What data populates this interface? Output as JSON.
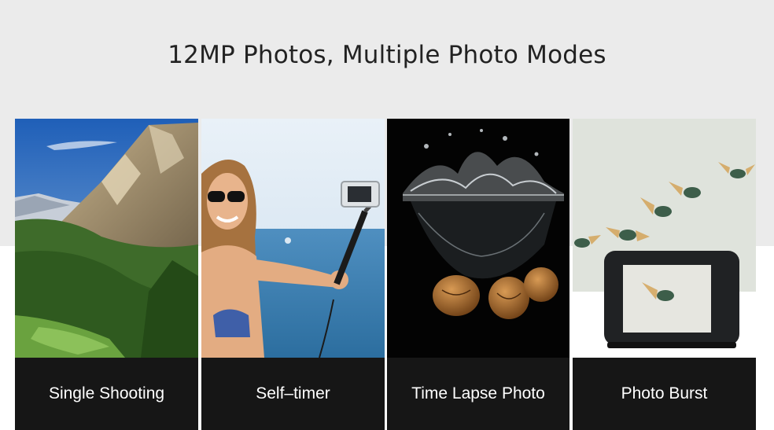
{
  "headline": "12MP Photos, Multiple Photo Modes",
  "panels": [
    {
      "label": "Single Shooting",
      "scene": "mountain-valley"
    },
    {
      "label": "Self–timer",
      "scene": "woman-selfie-stick-beach"
    },
    {
      "label": "Time Lapse Photo",
      "scene": "walnuts-splashing-water"
    },
    {
      "label": "Photo Burst",
      "scene": "flying-beetles-action-camera"
    }
  ],
  "colors": {
    "top_band": "#ebebeb",
    "caption_bg": "#161616",
    "headline_text": "#222222",
    "caption_text": "#ffffff"
  }
}
